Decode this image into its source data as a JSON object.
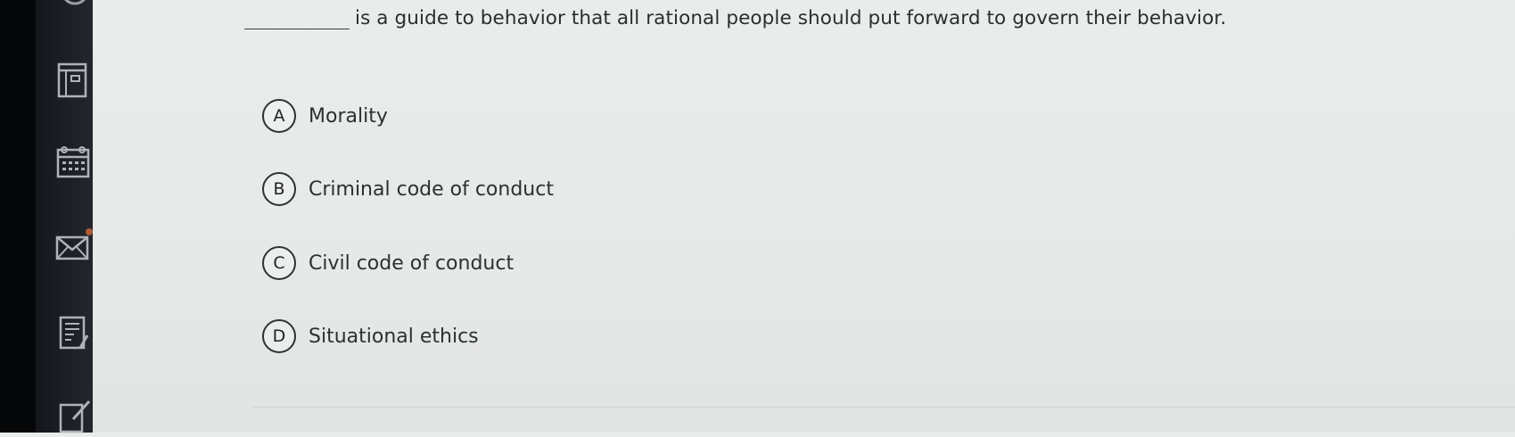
{
  "sidebar": {
    "icons": [
      {
        "name": "top-partial-icon"
      },
      {
        "name": "notebook-icon"
      },
      {
        "name": "calendar-icon"
      },
      {
        "name": "mail-icon"
      },
      {
        "name": "document-edit-icon"
      },
      {
        "name": "edit-icon"
      }
    ]
  },
  "question": {
    "text": "is a guide to behavior that all rational people should put forward to govern their behavior."
  },
  "options": [
    {
      "letter": "A",
      "text": "Morality"
    },
    {
      "letter": "B",
      "text": "Criminal code of conduct"
    },
    {
      "letter": "C",
      "text": "Civil code of conduct"
    },
    {
      "letter": "D",
      "text": "Situational ethics"
    }
  ],
  "colors": {
    "sidebar": "#15171c",
    "background": "#e7eae8",
    "text": "#2b2d30"
  }
}
